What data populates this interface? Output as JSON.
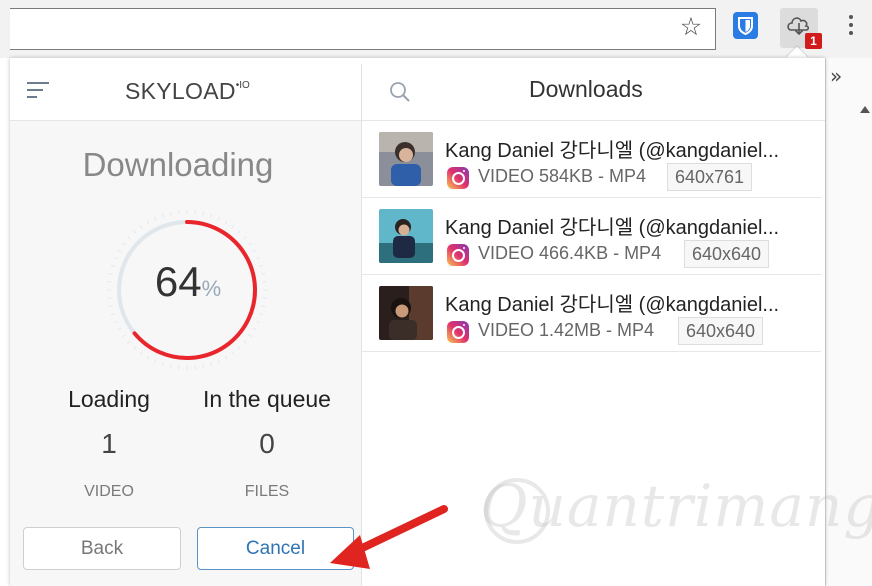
{
  "browser": {
    "star_icon": "star-icon",
    "extension_badge": "1",
    "more_icon": "kebab-icon",
    "overflow_chevron": "»"
  },
  "skyload": {
    "brand": "SKYLOAD",
    "brand_suffix": "IO",
    "status_title": "Downloading",
    "progress_number": "64",
    "progress_unit": "%",
    "progress_fraction": 0.64,
    "loading_label": "Loading",
    "loading_count": "1",
    "loading_unit": "VIDEO",
    "queue_label": "In the queue",
    "queue_count": "0",
    "queue_unit": "FILES",
    "back_label": "Back",
    "cancel_label": "Cancel",
    "accent_color": "#e8262b"
  },
  "downloads": {
    "title": "Downloads",
    "items": [
      {
        "name": "Kang Daniel 강다니엘 (@kangdaniel...",
        "meta": "VIDEO 584KB - MP4",
        "resolution": "640x761"
      },
      {
        "name": "Kang Daniel 강다니엘 (@kangdaniel...",
        "meta": "VIDEO 466.4KB - MP4",
        "resolution": "640x640"
      },
      {
        "name": "Kang Daniel 강다니엘 (@kangdaniel...",
        "meta": "VIDEO 1.42MB - MP4",
        "resolution": "640x640"
      }
    ]
  },
  "watermark": "Quantrimang"
}
